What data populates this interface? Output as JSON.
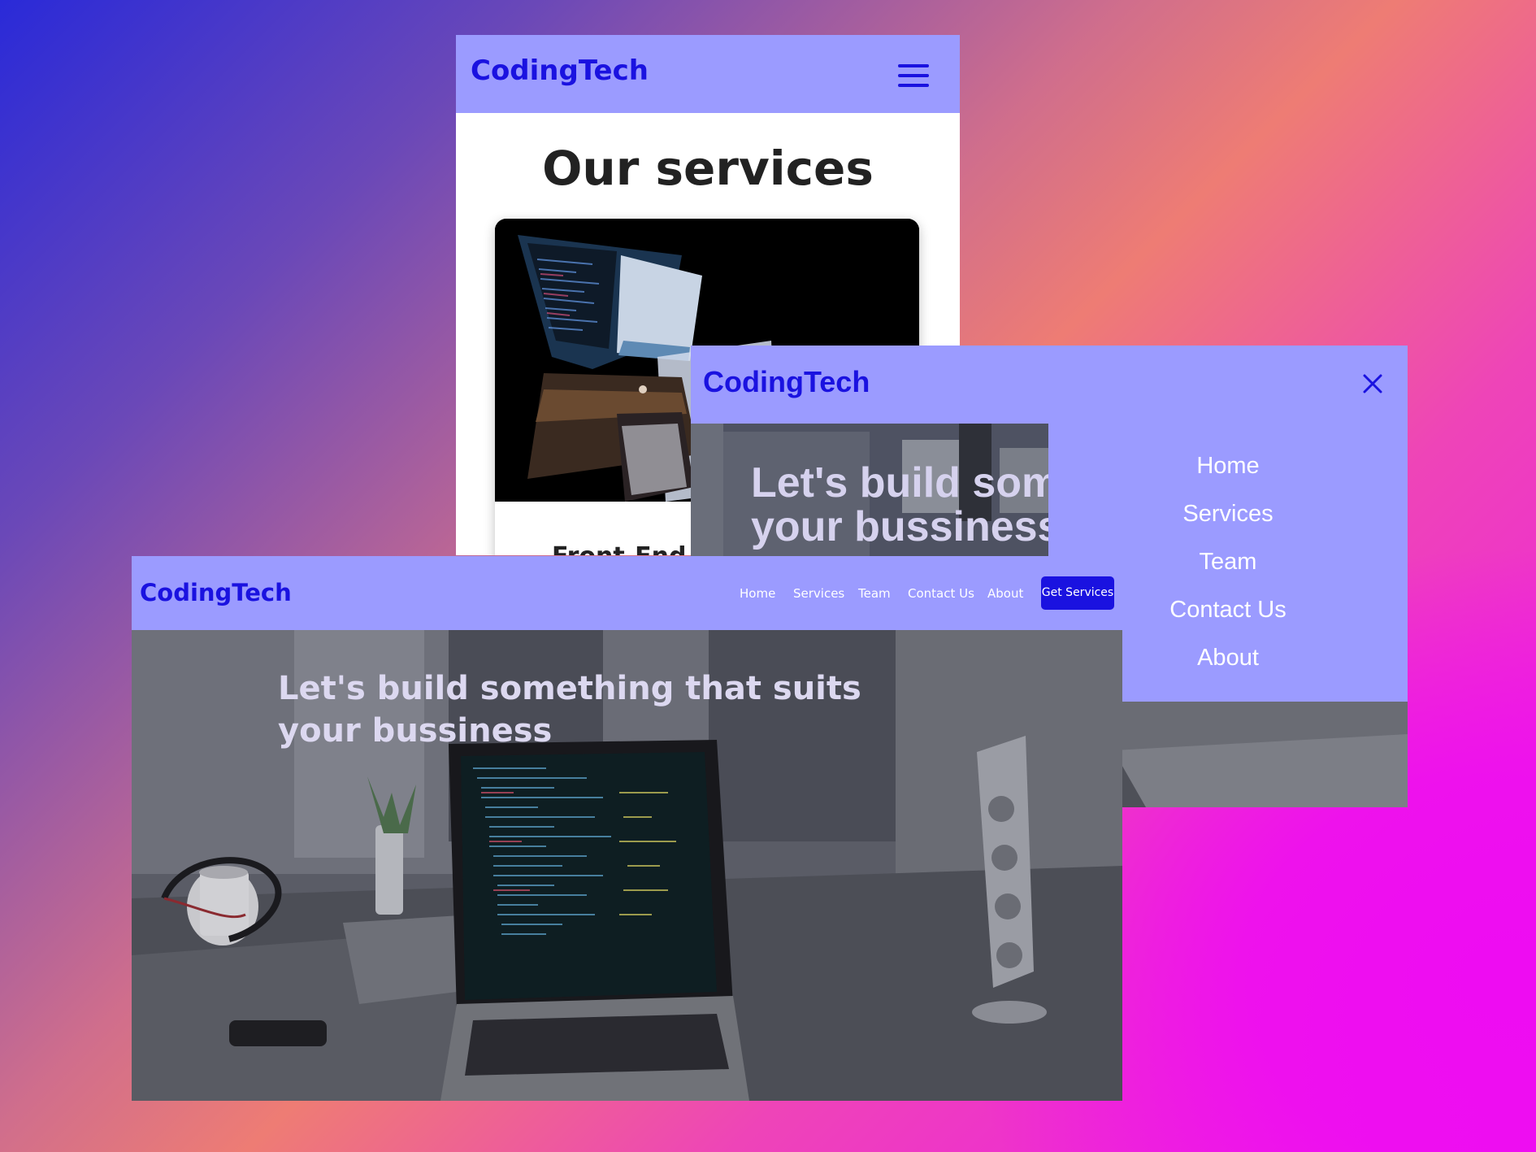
{
  "brand": {
    "name": "CodingTech",
    "logo_color": "#1a12e0",
    "nav_bg": "#9b9bff",
    "accent": "#1a12e0"
  },
  "mobile": {
    "menu_icon": "hamburger-menu-icon",
    "section_title": "Our services",
    "card_title": "Front-End"
  },
  "tablet": {
    "close_icon": "close-icon",
    "hero_heading": "Let's build something that suits your bussiness",
    "menu": [
      "Home",
      "Services",
      "Team",
      "Contact Us",
      "About"
    ]
  },
  "desktop": {
    "nav": [
      "Home",
      "Services",
      "Team",
      "Contact Us",
      "About"
    ],
    "cta": "Get Services",
    "hero_heading": "Let's build something that suits your bussiness"
  }
}
